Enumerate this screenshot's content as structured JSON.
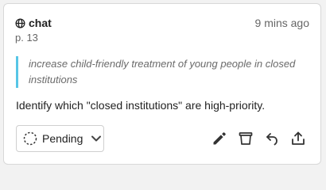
{
  "card": {
    "source_label": "chat",
    "source_icon": "globe-icon",
    "timestamp": "9 mins ago",
    "page_ref": "p. 13",
    "highlight_quote": "increase child-friendly treatment of young people in closed institutions",
    "comment": "Identify which \"closed institutions\" are high-priority.",
    "accent_color": "#57c6e6"
  },
  "status": {
    "label": "Pending",
    "icon": "pending-dotted-circle-icon",
    "dropdown_icon": "chevron-down-icon"
  },
  "actions": [
    {
      "name": "edit",
      "icon": "pencil-icon"
    },
    {
      "name": "archive",
      "icon": "archive-icon"
    },
    {
      "name": "undo",
      "icon": "undo-icon"
    },
    {
      "name": "share",
      "icon": "share-icon"
    }
  ]
}
